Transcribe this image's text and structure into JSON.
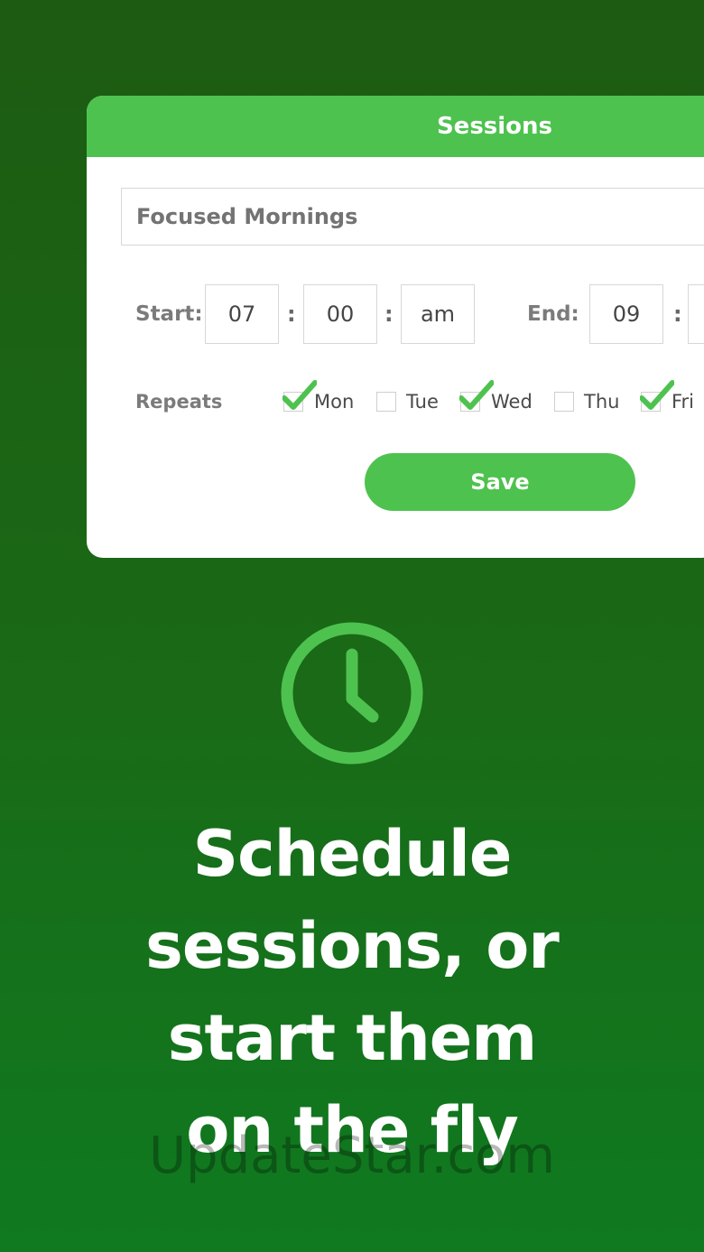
{
  "card": {
    "title": "Sessions",
    "session_name": "Focused Mornings",
    "start": {
      "label": "Start:",
      "hour": "07",
      "minute": "00",
      "ampm": "am"
    },
    "end": {
      "label": "End:",
      "hour": "09"
    },
    "time_separator": ":",
    "repeats_label": "Repeats",
    "days": [
      {
        "label": "Mon",
        "checked": true
      },
      {
        "label": "Tue",
        "checked": false
      },
      {
        "label": "Wed",
        "checked": true
      },
      {
        "label": "Thu",
        "checked": false
      },
      {
        "label": "Fri",
        "checked": true
      }
    ],
    "save_label": "Save"
  },
  "headline_lines": [
    "Schedule",
    "sessions, or",
    "start them",
    "on the fly"
  ],
  "watermark": "UpdateStar.com",
  "colors": {
    "background": "#1d5b12",
    "accent": "#4ec24f",
    "card": "#ffffff"
  },
  "icons": {
    "feature": "clock-icon",
    "checkbox_mark": "check-icon"
  }
}
